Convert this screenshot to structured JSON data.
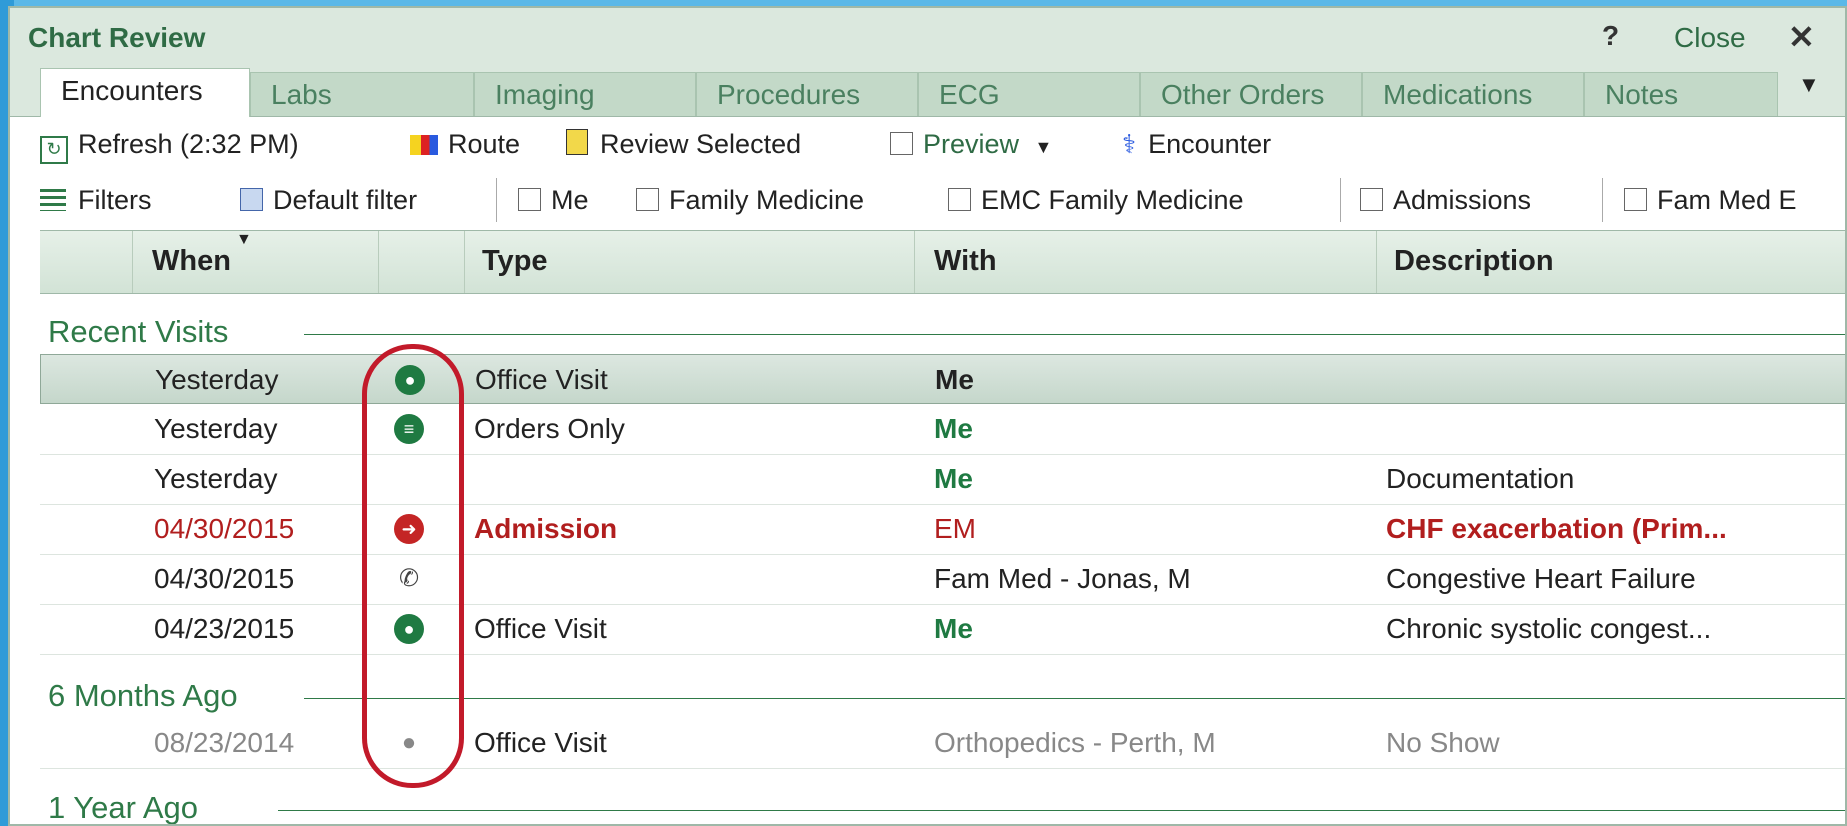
{
  "window": {
    "title": "Chart Review",
    "help_label": "?",
    "close_label": "Close",
    "close_icon": "✕"
  },
  "tabs": [
    {
      "label": "Encounters",
      "active": true
    },
    {
      "label": "Labs"
    },
    {
      "label": "Imaging"
    },
    {
      "label": "Procedures"
    },
    {
      "label": "ECG"
    },
    {
      "label": "Other Orders"
    },
    {
      "label": "Medications"
    },
    {
      "label": "Notes"
    }
  ],
  "toolbar": {
    "refresh": "Refresh (2:32 PM)",
    "route": "Route",
    "review_selected": "Review Selected",
    "preview": "Preview",
    "encounter": "Encounter"
  },
  "filters": {
    "label": "Filters",
    "default_filter": "Default filter",
    "me": "Me",
    "family_medicine": "Family Medicine",
    "emc_family_medicine": "EMC Family Medicine",
    "admissions": "Admissions",
    "fam_med_e": "Fam Med E"
  },
  "columns": {
    "when": "When",
    "type": "Type",
    "with": "With",
    "description": "Description"
  },
  "groups": {
    "recent": "Recent Visits",
    "six_months": "6 Months Ago",
    "one_year": "1 Year Ago"
  },
  "rows": [
    {
      "when": "Yesterday",
      "icon": "person-icon",
      "type": "Office Visit",
      "with": "Me",
      "description": ""
    },
    {
      "when": "Yesterday",
      "icon": "orders-icon",
      "type": "Orders Only",
      "with": "Me",
      "description": ""
    },
    {
      "when": "Yesterday",
      "icon": "",
      "type": "",
      "with": "Me",
      "description": "Documentation"
    },
    {
      "when": "04/30/2015",
      "icon": "admission-icon",
      "type": "Admission",
      "with": "EM",
      "description": "CHF exacerbation (Prim..."
    },
    {
      "when": "04/30/2015",
      "icon": "phone-icon",
      "type": "",
      "with": "Fam Med - Jonas, M",
      "description": "Congestive Heart Failure"
    },
    {
      "when": "04/23/2015",
      "icon": "person-icon",
      "type": "Office Visit",
      "with": "Me",
      "description": "Chronic systolic congest..."
    },
    {
      "when": "08/23/2014",
      "icon": "person-grey-icon",
      "type": "Office Visit",
      "with": "Orthopedics - Perth, M",
      "description": "No Show"
    }
  ],
  "colors": {
    "green": "#1f7a42",
    "red": "#b11e1e",
    "grey": "#888888",
    "highlight": "#c21a2a"
  }
}
